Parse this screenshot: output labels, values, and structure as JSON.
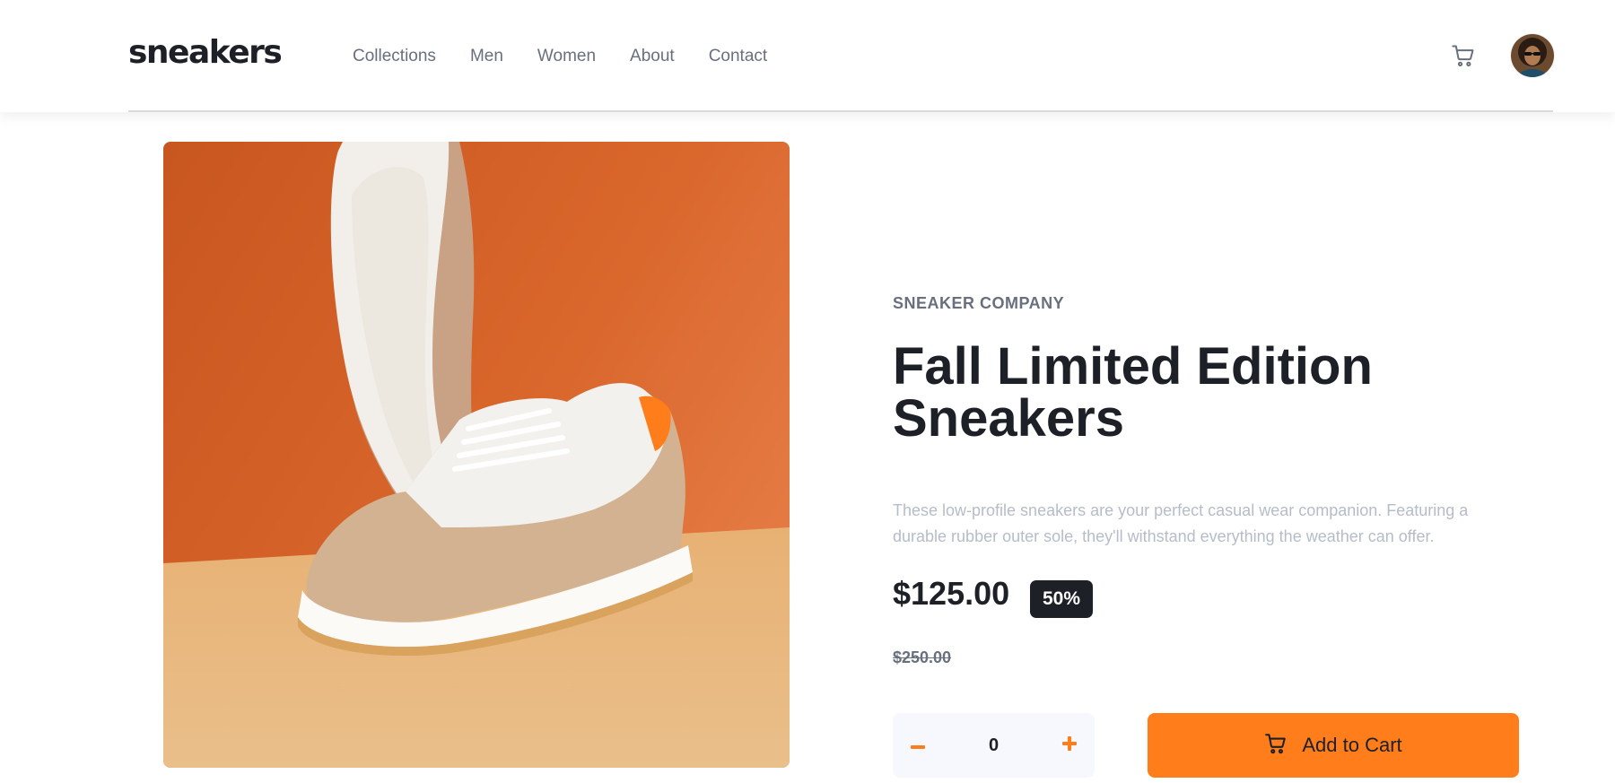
{
  "brand": {
    "logo_text": "sneakers"
  },
  "nav": {
    "items": [
      {
        "label": "Collections"
      },
      {
        "label": "Men"
      },
      {
        "label": "Women"
      },
      {
        "label": "About"
      },
      {
        "label": "Contact"
      }
    ]
  },
  "header": {
    "cart_icon": "cart-icon",
    "avatar_icon": "user-avatar"
  },
  "product": {
    "company": "SNEAKER COMPANY",
    "title": "Fall Limited Edition Sneakers",
    "description": "These low-profile sneakers are your perfect casual wear companion. Featuring a durable rubber outer sole, they'll withstand everything the weather can offer.",
    "price": "$125.00",
    "discount": "50%",
    "original_price": "$250.00",
    "image_alt": "Fall Limited Edition Sneakers"
  },
  "cart_controls": {
    "quantity": "0",
    "minus_icon": "minus-icon",
    "plus_icon": "plus-icon",
    "add_label": "Add to Cart",
    "add_icon": "cart-icon"
  },
  "colors": {
    "accent": "#ff7e1b",
    "dark": "#1d2026",
    "muted": "#69707d",
    "light_text": "#b6bcc8",
    "light_bg": "#f6f8fd"
  }
}
